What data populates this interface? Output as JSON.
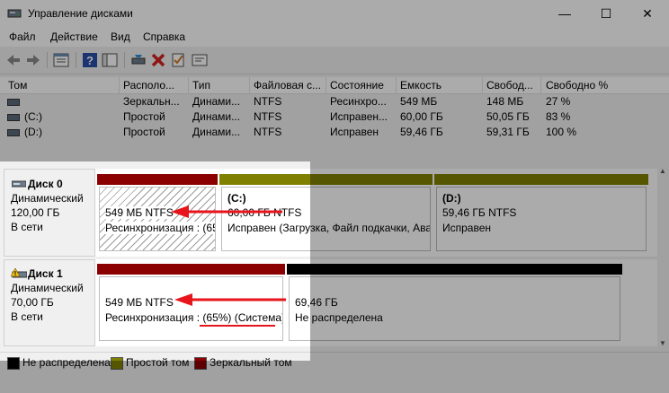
{
  "window": {
    "title": "Управление дисками",
    "controls": {
      "minimize": "—",
      "maximize": "☐",
      "close": "✕"
    }
  },
  "menu": [
    "Файл",
    "Действие",
    "Вид",
    "Справка"
  ],
  "toolbar_icons": [
    "back-icon",
    "forward-icon",
    "properties-icon",
    "help-icon",
    "console-icon",
    "connect-icon",
    "delete-icon",
    "check-icon",
    "details-icon"
  ],
  "volume_list": {
    "columns": [
      "Том",
      "Располо...",
      "Тип",
      "Файловая с...",
      "Состояние",
      "Емкость",
      "Свобод...",
      "Свободно %"
    ],
    "rows": [
      [
        "",
        "Зеркальн...",
        "Динами...",
        "NTFS",
        "Ресинхро...",
        "549 МБ",
        "148 МБ",
        "27 %"
      ],
      [
        "(C:)",
        "Простой",
        "Динами...",
        "NTFS",
        "Исправен...",
        "60,00 ГБ",
        "50,05 ГБ",
        "83 %"
      ],
      [
        "(D:)",
        "Простой",
        "Динами...",
        "NTFS",
        "Исправен",
        "59,46 ГБ",
        "59,31 ГБ",
        "100 %"
      ]
    ]
  },
  "disks": [
    {
      "name": "Диск 0",
      "type": "Динамический",
      "size": "120,00 ГБ",
      "state": "В сети",
      "partitions": [
        {
          "title": "",
          "line1": "549 МБ NTFS",
          "line2": "Ресинхронизация : (65",
          "color": "#8b0000"
        },
        {
          "title": "(C:)",
          "line1": "60,00 ГБ NTFS",
          "line2": "Исправен (Загрузка, Файл подкачки, Ава",
          "color": "#808000"
        },
        {
          "title": "(D:)",
          "line1": "59,46 ГБ NTFS",
          "line2": "Исправен",
          "color": "#808000"
        }
      ]
    },
    {
      "name": "Диск 1",
      "type": "Динамический",
      "size": "70,00 ГБ",
      "state": "В сети",
      "partitions": [
        {
          "title": "",
          "line1": "549 МБ NTFS",
          "line2": "Ресинхронизация : (65%) (Система)",
          "color": "#8b0000"
        },
        {
          "title": "",
          "line1": "69,46 ГБ",
          "line2": "Не распределена",
          "color": "#000000"
        }
      ]
    }
  ],
  "legend": [
    {
      "label": "Не распределена",
      "color": "#000000"
    },
    {
      "label": "Простой том",
      "color": "#808000"
    },
    {
      "label": "Зеркальный том",
      "color": "#8b0000"
    }
  ],
  "accent": {
    "arrow": "#e8141c"
  }
}
